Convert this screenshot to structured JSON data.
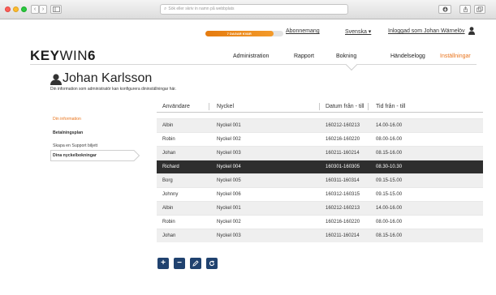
{
  "browser": {
    "url_placeholder": "Sök eller skriv in namn på webbplats",
    "back_icon": "chevron-left-icon",
    "forward_icon": "chevron-right-icon"
  },
  "topbar": {
    "trial_label": "7 DAGAR KVAR",
    "trial_remaining_fraction": 0.87,
    "subscription": "Abonnemang",
    "language": "Svenska ▾",
    "logged_in": "Inloggad som Johan Wärnelöv"
  },
  "logo": {
    "bold": "KEY",
    "thin": "WIN",
    "tail": "6"
  },
  "nav": {
    "items": [
      "Administration",
      "Rapport",
      "Bokning",
      "Händelselogg",
      "Inställningar"
    ],
    "active": "Bokning",
    "accent_item": "Inställningar",
    "accent_color": "#e9741c"
  },
  "profile": {
    "name": "Johan Karlsson",
    "subtitle": "Din information som administratör kan konfigurera dininställningar här."
  },
  "sidebar": {
    "items": [
      {
        "label": "Din information"
      },
      {
        "label": "Betalningsplan"
      },
      {
        "label": "Skapa en Support biljett"
      },
      {
        "label": "Dina nyckelbokningar"
      }
    ]
  },
  "table": {
    "headers": [
      "Användare",
      "Nyckel",
      "Datum från - till",
      "Tid från - till"
    ],
    "rows": [
      [
        "Albin",
        "Nyckel 001",
        "160212-160213",
        "14.00-16.00"
      ],
      [
        "Robin",
        "Nyckel 002",
        "160216-160220",
        "08.00-16.00"
      ],
      [
        "Johan",
        "Nyckel 003",
        "160211-160214",
        "08.15-16.00"
      ],
      [
        "Richard",
        "Nyckel 004",
        "160301-160305",
        "08.30-10.30"
      ],
      [
        "Borg",
        "Nyckel 005",
        "160311-160314",
        "09.15-15.00"
      ],
      [
        "Johnny",
        "Nyckel 006",
        "160312-160315",
        "09.15-15.00"
      ],
      [
        "Albin",
        "Nyckel 001",
        "160212-160213",
        "14.00-16.00"
      ],
      [
        "Robin",
        "Nyckel 002",
        "160216-160220",
        "08.00-16.00"
      ],
      [
        "Johan",
        "Nyckel 003",
        "160211-160214",
        "08.15-16.00"
      ]
    ],
    "selected_row": 3
  },
  "actions": {
    "add": "+",
    "remove": "−",
    "edit_icon": "pencil-icon",
    "refresh_icon": "refresh-icon"
  }
}
